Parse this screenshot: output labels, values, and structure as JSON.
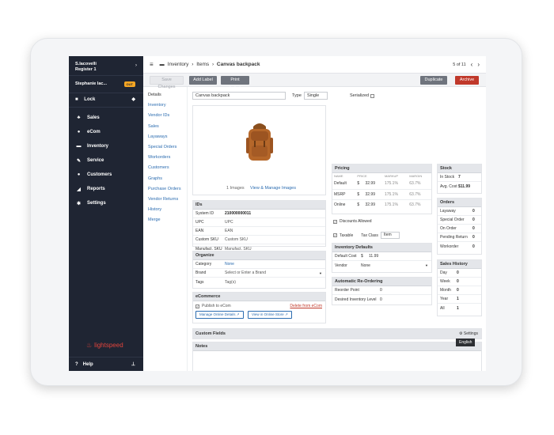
{
  "sidebar": {
    "user_name": "S.Iacovelli",
    "register": "Register 1",
    "employee": "Stephanie Iac...",
    "out_badge": "OUT",
    "lock": "Lock",
    "items": [
      {
        "label": "Sales",
        "icon": "sales-icon"
      },
      {
        "label": "eCom",
        "icon": "ecom-icon"
      },
      {
        "label": "Inventory",
        "icon": "inventory-icon"
      },
      {
        "label": "Service",
        "icon": "service-icon"
      },
      {
        "label": "Customers",
        "icon": "customers-icon"
      },
      {
        "label": "Reports",
        "icon": "reports-icon"
      },
      {
        "label": "Settings",
        "icon": "settings-icon"
      }
    ],
    "logo_text": "lightspeed",
    "help": "Help"
  },
  "topbar": {
    "crumb_inventory": "Inventory",
    "crumb_sep1": "›",
    "crumb_items": "Items",
    "crumb_sep2": "›",
    "crumb_current": "Canvas backpack",
    "pager": "5 of 11"
  },
  "toolbar": {
    "save": "Save Changes",
    "add_label": "Add Label",
    "print_label": "Print Label",
    "duplicate": "Duplicate",
    "archive": "Archive"
  },
  "subnav": [
    "Details",
    "Inventory",
    "Vendor IDs",
    "Sales",
    "Layaways",
    "Special Orders",
    "Workorders",
    "Customers",
    "Graphs",
    "Purchase Orders",
    "Vendor Returns",
    "History",
    "Merge"
  ],
  "item": {
    "name": "Canvas backpack",
    "type_label": "Type",
    "type_value": "Single",
    "serialized_label": "Serialized"
  },
  "images": {
    "count": "1 Images",
    "manage": "View & Manage Images"
  },
  "ids": {
    "title": "IDs",
    "rows": [
      {
        "k": "System ID",
        "v": "210000000011"
      },
      {
        "k": "UPC",
        "v": "UPC"
      },
      {
        "k": "EAN",
        "v": "EAN"
      },
      {
        "k": "Custom SKU",
        "v": "Custom SKU"
      },
      {
        "k": "Manufact. SKU",
        "v": "Manufact. SKU"
      }
    ]
  },
  "organize": {
    "title": "Organize",
    "category_label": "Category",
    "category_value": "None",
    "brand_label": "Brand",
    "brand_value": "Select or Enter a Brand",
    "tags_label": "Tags",
    "tags_value": "Tag(s)"
  },
  "ecommerce": {
    "title": "eCommerce",
    "publish": "Publish to eCom",
    "delete": "Delete from eCom",
    "manage": "Manage Online Details",
    "view": "View in Online Store"
  },
  "pricing": {
    "title": "Pricing",
    "headers": [
      "NAME",
      "PRICE",
      "MARKUP",
      "MARGIN"
    ],
    "rows": [
      {
        "name": "Default",
        "cur": "$",
        "price": "32.99",
        "markup": "175.1%",
        "margin": "63.7%"
      },
      {
        "name": "MSRP",
        "cur": "$",
        "price": "32.99",
        "markup": "175.1%",
        "margin": "63.7%"
      },
      {
        "name": "Online",
        "cur": "$",
        "price": "32.99",
        "markup": "175.1%",
        "margin": "63.7%"
      }
    ],
    "discounts": "Discounts Allowed",
    "taxable": "Taxable",
    "tax_class_label": "Tax Class",
    "tax_class_value": "Item"
  },
  "inventory_defaults": {
    "title": "Inventory Defaults",
    "default_cost_label": "Default Cost",
    "cur": "$",
    "default_cost": "11.99",
    "vendor_label": "Vendor",
    "vendor_value": "None"
  },
  "reorder": {
    "title": "Automatic Re-Ordering",
    "point_label": "Reorder Point",
    "point_value": "0",
    "level_label": "Desired Inventory Level",
    "level_value": "0"
  },
  "stock": {
    "title": "Stock",
    "in_stock_label": "In Stock",
    "in_stock": "7",
    "avg_cost_label": "Avg. Cost",
    "avg_cost": "$11.99"
  },
  "orders": {
    "title": "Orders",
    "rows": [
      {
        "k": "Layaway",
        "v": "0"
      },
      {
        "k": "Special Order",
        "v": "0"
      },
      {
        "k": "On Order",
        "v": "0"
      },
      {
        "k": "Pending Return",
        "v": "0"
      },
      {
        "k": "Workorder",
        "v": "0"
      }
    ]
  },
  "sales_history": {
    "title": "Sales History",
    "rows": [
      {
        "k": "Day",
        "v": "0"
      },
      {
        "k": "Week",
        "v": "0"
      },
      {
        "k": "Month",
        "v": "0"
      },
      {
        "k": "Year",
        "v": "1"
      },
      {
        "k": "All",
        "v": "1"
      }
    ]
  },
  "custom_fields": {
    "title": "Custom Fields",
    "settings": "Settings"
  },
  "notes": {
    "title": "Notes"
  },
  "language": "English",
  "colors": {
    "sidebar": "#1f2533",
    "accent_link": "#2b6cb0",
    "archive": "#c0392b",
    "logo": "#e4443b"
  }
}
